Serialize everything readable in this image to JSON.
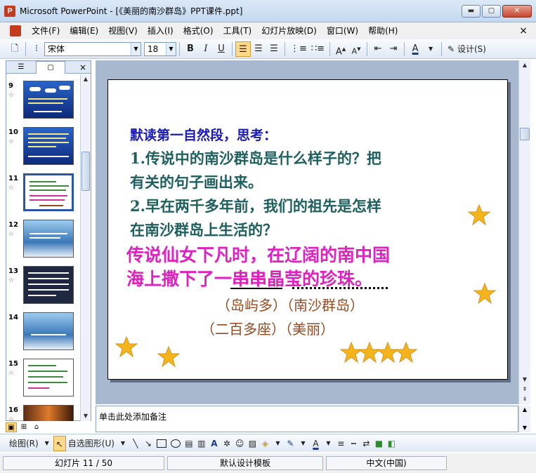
{
  "window": {
    "app_icon_letter": "P",
    "title": "Microsoft PowerPoint - [《美丽的南沙群岛》PPT课件.ppt]",
    "minimize": "▬",
    "maximize": "▢",
    "close": "✕"
  },
  "menu": {
    "items": [
      "文件(F)",
      "编辑(E)",
      "视图(V)",
      "插入(I)",
      "格式(O)",
      "工具(T)",
      "幻灯片放映(D)",
      "窗口(W)",
      "帮助(H)"
    ],
    "close": "×"
  },
  "toolbar": {
    "font_name": "宋体",
    "font_size": "18",
    "bold": "B",
    "italic": "I",
    "underline": "U",
    "design_label": "设计(S)"
  },
  "left_pane": {
    "tab_outline": "☰",
    "tab_slides": "▢",
    "close": "×",
    "thumbnails": [
      {
        "num": "9",
        "star": "☆"
      },
      {
        "num": "10",
        "star": "☆"
      },
      {
        "num": "11",
        "star": "☆"
      },
      {
        "num": "12",
        "star": "☆"
      },
      {
        "num": "13",
        "star": "☆"
      },
      {
        "num": "14",
        "star": ""
      },
      {
        "num": "15",
        "star": "☆"
      },
      {
        "num": "16",
        "star": "☆"
      }
    ]
  },
  "slide": {
    "line1": "默读第一自然段，思考：",
    "line2": "1.传说中的南沙群岛是什么样子的？把",
    "line3": "有关的句子画出来。",
    "line4": "2.早在两千多年前，我们的祖先是怎样",
    "line5": "在南沙群岛上生活的？",
    "line6": "传说仙女下凡时，在辽阔的南中国",
    "line7": "海上撒下了一串串晶莹的珍珠。",
    "answer1": "（岛屿多）（南沙群岛）",
    "answer2": "（二百多座）（美丽）"
  },
  "notes": {
    "placeholder": "单击此处添加备注"
  },
  "drawbar": {
    "draw": "绘图(R)",
    "autoshapes": "自选图形(U)"
  },
  "status": {
    "slide_info": "幻灯片 11 / 50",
    "template": "默认设计模板",
    "language": "中文(中国)"
  },
  "colors": {
    "slide_blue": "#1a1ab8",
    "slide_green": "#1e5f5f",
    "slide_pink": "#e020c0",
    "slide_brown": "#944a1f",
    "star_gold": "#f5b31c"
  }
}
